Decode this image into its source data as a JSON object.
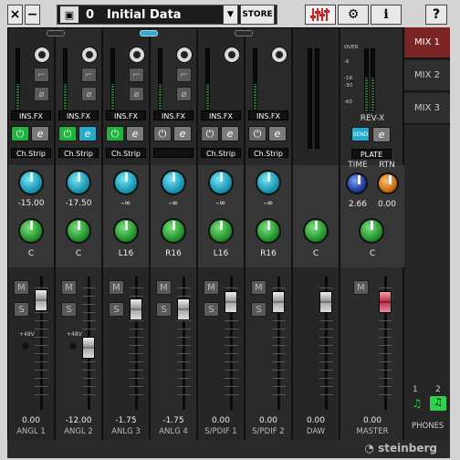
{
  "toolbar": {
    "close_icon": "×",
    "minimize_icon": "−",
    "doc_icon": "▣",
    "preset_number": "0",
    "preset_name": "Initial Data",
    "dropdown_icon": "▼",
    "store_label": "STORE",
    "mixer_icon": "mixer-icon",
    "settings_icon": "⚙",
    "info_icon": "i",
    "help_icon": "?"
  },
  "channels": [
    {
      "name": "ANGL 1",
      "insfx": "INS.FX",
      "chstrip": "Ch.Strip",
      "send": "-15.00",
      "pan": "C",
      "fader": "0.00",
      "mute": "M",
      "solo": "S"
    },
    {
      "name": "ANGL 2",
      "insfx": "INS.FX",
      "chstrip": "Ch.Strip",
      "send": "-17.50",
      "pan": "C",
      "fader": "-12.00",
      "mute": "M",
      "solo": "S",
      "phantom": "+48V"
    },
    {
      "name": "ANLG 3",
      "insfx": "INS.FX",
      "chstrip": "Ch.Strip",
      "send": "-∞",
      "pan": "L16",
      "fader": "-1.75",
      "mute": "M",
      "solo": "S"
    },
    {
      "name": "ANLG 4",
      "insfx": "INS.FX",
      "send": "-∞",
      "pan": "R16",
      "fader": "-1.75",
      "mute": "M",
      "solo": "S"
    },
    {
      "name": "S/PDIF 1",
      "insfx": "INS.FX",
      "chstrip": "Ch.Strip",
      "send": "-∞",
      "pan": "L16",
      "fader": "0.00",
      "mute": "M",
      "solo": "S"
    },
    {
      "name": "S/PDIF 2",
      "insfx": "INS.FX",
      "chstrip": "Ch.Strip",
      "send": "-∞",
      "pan": "R16",
      "fader": "0.00",
      "mute": "M",
      "solo": "S"
    },
    {
      "name": "DAW",
      "pan": "C",
      "fader": "0.00"
    }
  ],
  "ch1_phantom": "+48V",
  "master": {
    "name": "MASTER",
    "fader": "0.00",
    "pan": "C",
    "mute": "M",
    "revx": "REV-X",
    "send_btn": "SEND",
    "plate": "PLATE",
    "time_label": "TIME",
    "rtn_label": "RTN",
    "time_val": "2.66",
    "rtn_val": "0.00",
    "scale": [
      "OVER",
      "-6",
      "-18",
      "-30",
      "-60"
    ]
  },
  "mix_tabs": [
    "MIX 1",
    "MIX 2",
    "MIX 3"
  ],
  "phones": {
    "label": "PHONES",
    "n1": "1",
    "n2": "2"
  },
  "brand": "steinberg"
}
